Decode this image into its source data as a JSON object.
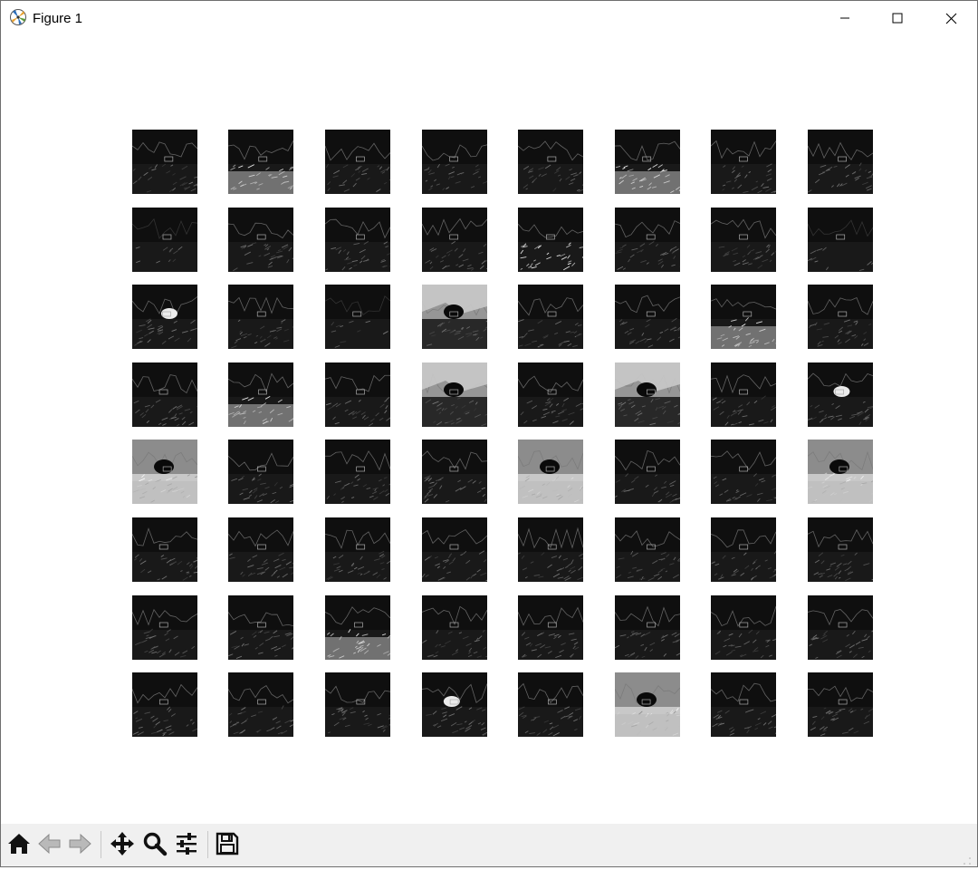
{
  "window": {
    "title": "Figure 1",
    "app_icon": "matplotlib-icon",
    "controls": [
      "minimize-icon",
      "maximize-icon",
      "close-icon"
    ]
  },
  "figure": {
    "rows": 8,
    "cols": 8,
    "colormap": "gray",
    "subplots": [
      [
        "edge",
        "bright-bottom",
        "dark-sky",
        "edge",
        "edge",
        "dark-bright-bottom",
        "edge",
        "edge"
      ],
      [
        "dark",
        "edge",
        "edge",
        "edge",
        "bright-mid",
        "edge",
        "edge",
        "dark"
      ],
      [
        "bright-center",
        "edge",
        "dark",
        "bright-sky",
        "edge",
        "edge",
        "bright-bottom",
        "edge"
      ],
      [
        "edge",
        "bright-bottom",
        "edge",
        "bright-sky",
        "edge",
        "bright-sky",
        "edge",
        "bright-center"
      ],
      [
        "bright",
        "edge",
        "edge",
        "edge",
        "bright",
        "edge",
        "edge",
        "bright"
      ],
      [
        "edge",
        "edge",
        "edge",
        "edge",
        "edge",
        "edge",
        "edge",
        "edge"
      ],
      [
        "edge",
        "edge",
        "bright-bottom",
        "edge",
        "edge",
        "edge",
        "edge",
        "edge"
      ],
      [
        "edge",
        "edge",
        "edge",
        "bright-center",
        "edge",
        "bright",
        "edge",
        "edge"
      ]
    ]
  },
  "toolbar": {
    "buttons": [
      {
        "name": "home-button",
        "icon": "home-icon"
      },
      {
        "name": "back-button",
        "icon": "back-arrow-icon"
      },
      {
        "name": "forward-button",
        "icon": "forward-arrow-icon"
      },
      {
        "name": "pan-button",
        "icon": "move-arrows-icon"
      },
      {
        "name": "zoom-button",
        "icon": "magnifier-icon"
      },
      {
        "name": "configure-subplots-button",
        "icon": "sliders-icon"
      },
      {
        "name": "save-button",
        "icon": "floppy-disk-icon"
      }
    ]
  }
}
